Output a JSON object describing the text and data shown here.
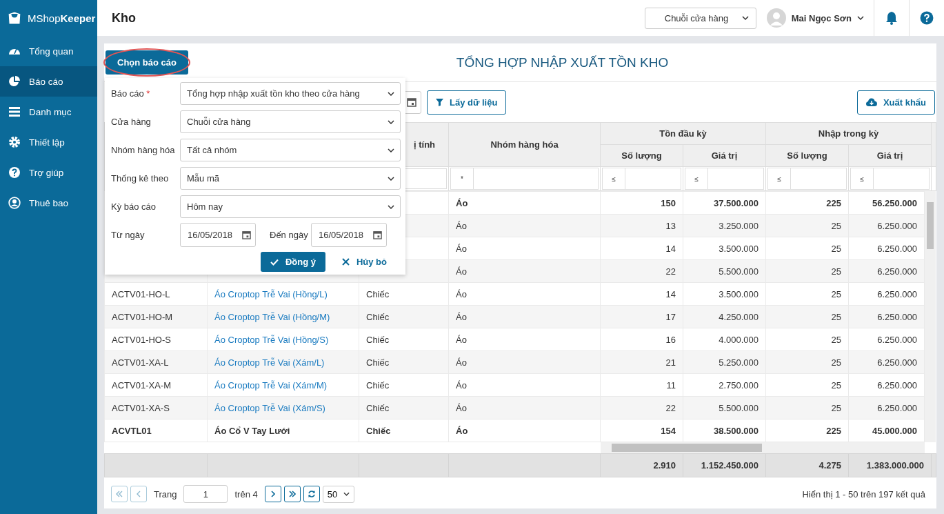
{
  "app": {
    "logo": "MShop**Keeper**"
  },
  "sidebar": {
    "items": [
      {
        "label": "Tổng quan",
        "kind": "gauge",
        "selected": false
      },
      {
        "label": "Báo cáo",
        "kind": "pie",
        "selected": true
      },
      {
        "label": "Danh mục",
        "kind": "list",
        "selected": false
      },
      {
        "label": "Thiết lập",
        "kind": "gear",
        "selected": false
      },
      {
        "label": "Trợ giúp",
        "kind": "help",
        "selected": false
      },
      {
        "label": "Thuê bao",
        "kind": "user",
        "selected": false
      }
    ]
  },
  "header": {
    "title": "Kho",
    "store_select": "Chuỗi cửa hàng",
    "user": "Mai Ngọc Sơn"
  },
  "report": {
    "title": "TỔNG HỢP NHẬP XUẤT TỒN KHO",
    "choose_button": "Chọn báo cáo",
    "fetch_button": "Lấy dữ liệu",
    "export_button": "Xuất khẩu"
  },
  "popup": {
    "fields": [
      {
        "label": "Báo cáo",
        "required": true,
        "value": "Tổng hợp nhập xuất tồn kho theo cửa hàng"
      },
      {
        "label": "Cửa hàng",
        "required": false,
        "value": "Chuỗi cửa hàng"
      },
      {
        "label": "Nhóm hàng hóa",
        "required": false,
        "value": "Tất cả nhóm"
      },
      {
        "label": "Thống kê theo",
        "required": false,
        "value": "Mẫu mã"
      },
      {
        "label": "Kỳ báo cáo",
        "required": false,
        "value": "Hôm nay"
      }
    ],
    "dates": [
      {
        "label": "Từ ngày",
        "value": "16/05/2018"
      },
      {
        "label": "Đến ngày",
        "value": "16/05/2018"
      }
    ],
    "ok_button": "Đồng ý",
    "cancel_button": "Hủy bỏ"
  },
  "table": {
    "column_3": {
      "label": "ị tính"
    },
    "column_4": {
      "label": "Nhóm hàng hóa",
      "filter": "*"
    },
    "groups": [
      "Tồn đầu kỳ",
      "Nhập trong kỳ"
    ],
    "sub_columns": [
      {
        "label": "Số lượng",
        "filter": "≤"
      },
      {
        "label": "Giá trị",
        "filter": "≤"
      },
      {
        "label": "Số lượng",
        "filter": "≤"
      },
      {
        "label": "Giá trị",
        "filter": "≤"
      }
    ],
    "rows": [
      {
        "group": "Áo",
        "bold": true,
        "values": [
          "150",
          "37.500.000",
          "225",
          "56.250.000"
        ]
      },
      {
        "group": "Áo",
        "bold": false,
        "values": [
          "13",
          "3.250.000",
          "25",
          "6.250.000"
        ]
      },
      {
        "group": "Áo",
        "bold": false,
        "values": [
          "14",
          "3.500.000",
          "25",
          "6.250.000"
        ]
      },
      {
        "group": "Áo",
        "bold": false,
        "values": [
          "22",
          "5.500.000",
          "25",
          "6.250.000"
        ]
      },
      {
        "code": "ACTV01-HO-L",
        "name": "Áo Croptop Trễ Vai (Hồng/L)",
        "unit": "Chiếc",
        "group": "Áo",
        "bold": false,
        "values": [
          "14",
          "3.500.000",
          "25",
          "6.250.000"
        ]
      },
      {
        "code": "ACTV01-HO-M",
        "name": "Áo Croptop Trễ Vai (Hồng/M)",
        "unit": "Chiếc",
        "group": "Áo",
        "bold": false,
        "values": [
          "17",
          "4.250.000",
          "25",
          "6.250.000"
        ]
      },
      {
        "code": "ACTV01-HO-S",
        "name": "Áo Croptop Trễ Vai (Hồng/S)",
        "unit": "Chiếc",
        "group": "Áo",
        "bold": false,
        "values": [
          "16",
          "4.000.000",
          "25",
          "6.250.000"
        ]
      },
      {
        "code": "ACTV01-XA-L",
        "name": "Áo Croptop Trễ Vai (Xám/L)",
        "unit": "Chiếc",
        "group": "Áo",
        "bold": false,
        "values": [
          "21",
          "5.250.000",
          "25",
          "6.250.000"
        ]
      },
      {
        "code": "ACTV01-XA-M",
        "name": "Áo Croptop Trễ Vai (Xám/M)",
        "unit": "Chiếc",
        "group": "Áo",
        "bold": false,
        "values": [
          "11",
          "2.750.000",
          "25",
          "6.250.000"
        ]
      },
      {
        "code": "ACTV01-XA-S",
        "name": "Áo Croptop Trễ Vai (Xám/S)",
        "unit": "Chiếc",
        "group": "Áo",
        "bold": false,
        "values": [
          "22",
          "5.500.000",
          "25",
          "6.250.000"
        ]
      },
      {
        "code": "ACVTL01",
        "name": "Áo Cổ V Tay Lưới",
        "unit": "Chiếc",
        "group": "Áo",
        "bold": true,
        "values": [
          "154",
          "38.500.000",
          "225",
          "45.000.000"
        ]
      }
    ],
    "totals": [
      "2.910",
      "1.152.450.000",
      "4.275",
      "1.383.000.000"
    ]
  },
  "pagination": {
    "page_label": "Trang",
    "page": "1",
    "of_label": "trên 4",
    "page_size": "50",
    "summary": "Hiển thị 1 - 50 trên 197 kết quả"
  }
}
